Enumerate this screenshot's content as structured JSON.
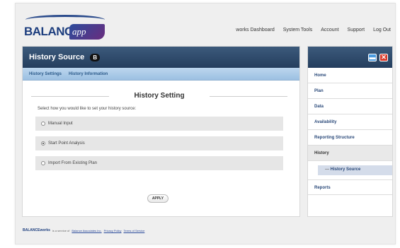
{
  "header": {
    "brand": "BALANCE",
    "brand_suffix": "app",
    "nav": [
      "works Dashboard",
      "System Tools",
      "Account",
      "Support",
      "Log Out"
    ]
  },
  "main": {
    "title": "History Source",
    "help": "B",
    "tabs": [
      "History Settings",
      "History Information"
    ],
    "section_title": "History Setting",
    "prompt": "Select how you would like to set your history source:",
    "options": [
      {
        "label": "Manual Input",
        "checked": false
      },
      {
        "label": "Start Point Analysis",
        "checked": true
      },
      {
        "label": "Import From Existing Plan",
        "checked": false
      }
    ],
    "apply_label": "APPLY"
  },
  "sidebar": {
    "items": [
      "Home",
      "Plan",
      "Data",
      "Availability",
      "Reporting Structure",
      "History"
    ],
    "sub_item": "History Source",
    "last_item": "Reports"
  },
  "footer": {
    "brand": "BALANCEworks",
    "text": "is a service of",
    "company": "Balance Associates Inc.",
    "privacy": "Privacy Policy",
    "terms": "Terms of Service"
  },
  "colors": {
    "header_bar": "#2c486a",
    "tab_bar": "#aecbe8",
    "accent": "#2b4a7a",
    "close_button": "#d93a2b",
    "minimize_button": "#4a9be0"
  }
}
